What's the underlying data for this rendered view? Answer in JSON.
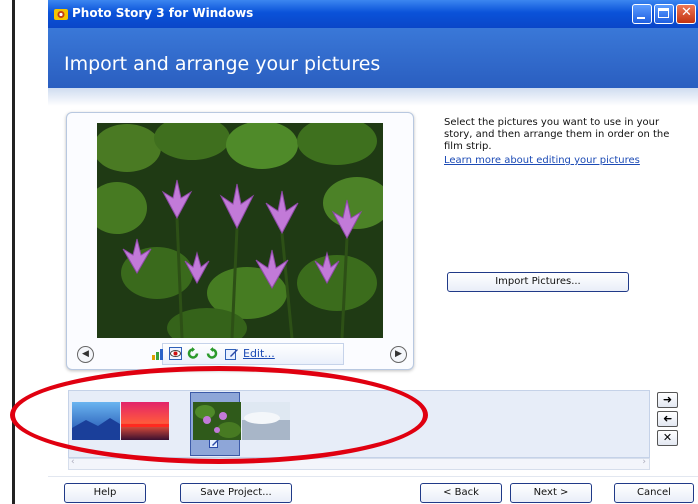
{
  "window": {
    "title": "Photo Story 3 for Windows"
  },
  "header": {
    "title": "Import and arrange your pictures"
  },
  "instructions": {
    "text": "Select the pictures you want to use in your story, and then arrange them in order on the film strip.",
    "learn_more": "Learn more about editing your pictures"
  },
  "preview": {
    "nav_prev_icon": "arrow-left-circle-icon",
    "nav_next_icon": "arrow-right-circle-icon",
    "edit_label": "Edit...",
    "tools": [
      "auto-correct-icon",
      "red-eye-icon",
      "rotate-left-icon",
      "rotate-right-icon",
      "edit-icon"
    ]
  },
  "buttons": {
    "import": "Import Pictures...",
    "help": "Help",
    "save_project": "Save Project...",
    "back": "< Back",
    "next": "Next >",
    "cancel": "Cancel"
  },
  "filmstrip": {
    "thumbnails": [
      "blue-mountains",
      "sunset",
      "water-lilies",
      "clouds"
    ],
    "selected_index": 2,
    "side_buttons": [
      "move-right-icon",
      "move-left-icon",
      "remove-icon"
    ]
  },
  "colors": {
    "accent": "#2a5ec0",
    "titlebar": "#0a52d9",
    "annotation": "#e00010"
  }
}
